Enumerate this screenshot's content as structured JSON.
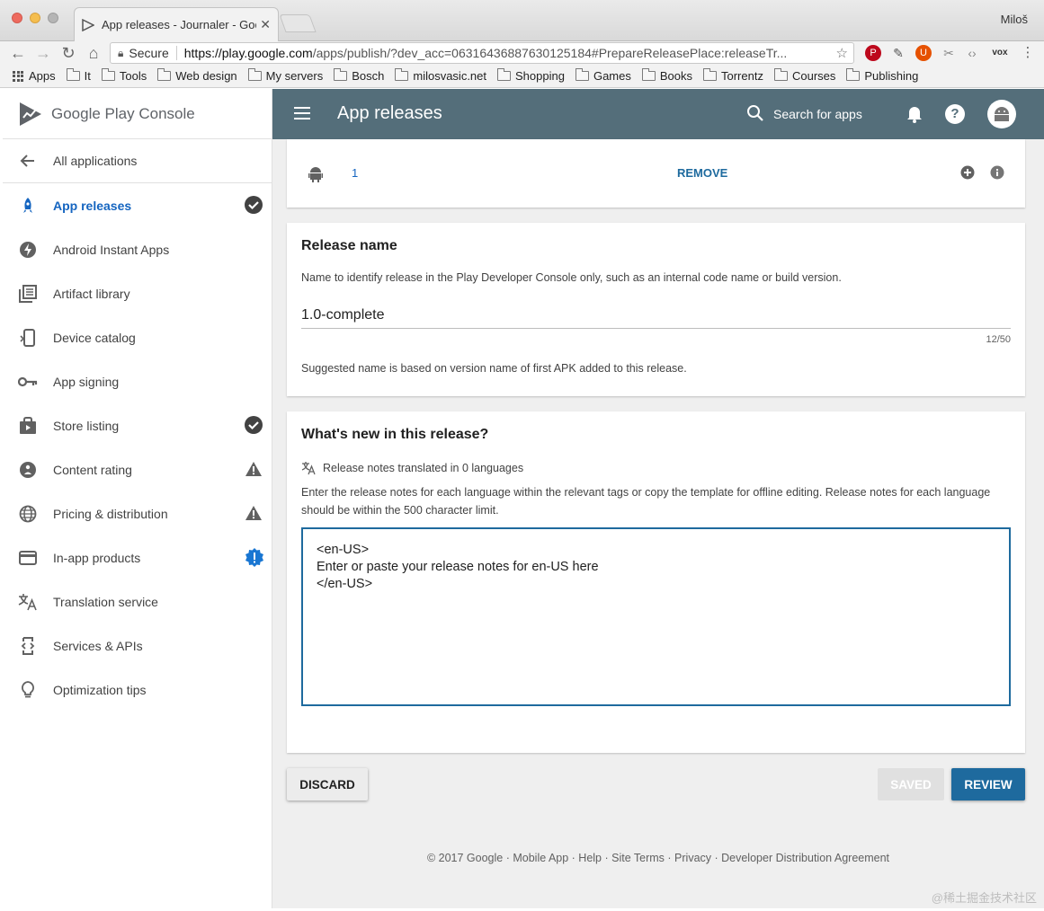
{
  "browser": {
    "tab_title": "App releases - Journaler - Goo",
    "profile_name": "Miloš",
    "secure_label": "Secure",
    "url_host": "https://play.google.com",
    "url_path": "/apps/publish/?dev_acc=06316436887630125184#PrepareReleasePlace:releaseTr...",
    "extension_label": "vox",
    "bookmarks": [
      "Apps",
      "It",
      "Tools",
      "Web design",
      "My servers",
      "Bosch",
      "milosvasic.net",
      "Shopping",
      "Games",
      "Books",
      "Torrentz",
      "Courses",
      "Publishing"
    ]
  },
  "brand": {
    "name": "Google Play Console"
  },
  "sidebar": {
    "back_label": "All applications",
    "items": [
      {
        "label": "App releases",
        "icon": "rocket-icon",
        "status": "check"
      },
      {
        "label": "Android Instant Apps",
        "icon": "bolt-icon",
        "status": ""
      },
      {
        "label": "Artifact library",
        "icon": "library-icon",
        "status": ""
      },
      {
        "label": "Device catalog",
        "icon": "device-icon",
        "status": ""
      },
      {
        "label": "App signing",
        "icon": "key-icon",
        "status": ""
      },
      {
        "label": "Store listing",
        "icon": "store-icon",
        "status": "check"
      },
      {
        "label": "Content rating",
        "icon": "rating-icon",
        "status": "warning"
      },
      {
        "label": "Pricing & distribution",
        "icon": "globe-icon",
        "status": "warning"
      },
      {
        "label": "In-app products",
        "icon": "card-icon",
        "status": "alert"
      },
      {
        "label": "Translation service",
        "icon": "translate-icon",
        "status": ""
      },
      {
        "label": "Services & APIs",
        "icon": "api-icon",
        "status": ""
      },
      {
        "label": "Optimization tips",
        "icon": "bulb-icon",
        "status": ""
      }
    ]
  },
  "header": {
    "title": "App releases",
    "search_label": "Search for apps"
  },
  "apk": {
    "count": "1",
    "remove_label": "REMOVE"
  },
  "release_name": {
    "heading": "Release name",
    "description": "Name to identify release in the Play Developer Console only, such as an internal code name or build version.",
    "value": "1.0-complete",
    "counter": "12/50",
    "hint": "Suggested name is based on version name of first APK added to this release."
  },
  "whats_new": {
    "heading": "What's new in this release?",
    "translated_label": "Release notes translated in 0 languages",
    "instructions": "Enter the release notes for each language within the relevant tags or copy the template for offline editing. Release notes for each language should be within the 500 character limit.",
    "notes": "<en-US>\nEnter or paste your release notes for en-US here\n</en-US>"
  },
  "actions": {
    "discard": "DISCARD",
    "saved": "SAVED",
    "review": "REVIEW"
  },
  "footer": {
    "text": "© 2017 Google · Mobile App · Help · Site Terms · Privacy · Developer Distribution Agreement"
  },
  "watermark": "@稀土掘金技术社区",
  "colors": {
    "header_bg": "#546e7a",
    "accent": "#1e6a9e",
    "active_nav": "#1565c0",
    "alert_badge": "#1976d2"
  }
}
